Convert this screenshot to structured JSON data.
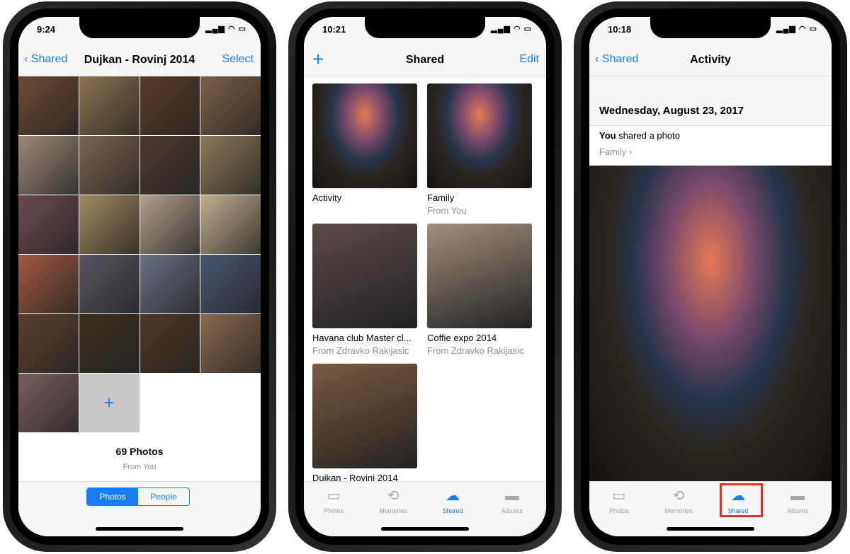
{
  "phone1": {
    "time": "9:24",
    "back": "Shared",
    "title": "Dujkan - Rovinj 2014",
    "right": "Select",
    "count": "69 Photos",
    "from": "From You",
    "segments": [
      "Photos",
      "People"
    ],
    "add_icon": "plus-icon"
  },
  "phone2": {
    "time": "10:21",
    "title": "Shared",
    "right": "Edit",
    "add_icon": "plus-icon",
    "albums": [
      {
        "name": "Activity",
        "sub": ""
      },
      {
        "name": "Family",
        "sub": "From You"
      },
      {
        "name": "Havana club Master cl...",
        "sub": "From Zdravko Rakijasic"
      },
      {
        "name": "Coffie expo 2014",
        "sub": "From Zdravko Rakijasic"
      },
      {
        "name": "Dujkan - Rovinj 2014",
        "sub": ""
      }
    ]
  },
  "phone3": {
    "time": "10:18",
    "back": "Shared",
    "title": "Activity",
    "date": "Wednesday, August 23, 2017",
    "you": "You",
    "action": " shared a photo",
    "album": "Family ›"
  },
  "tabs": [
    {
      "label": "Photos",
      "icon": "photos-icon"
    },
    {
      "label": "Memories",
      "icon": "memories-icon"
    },
    {
      "label": "Shared",
      "icon": "cloud-icon"
    },
    {
      "label": "Albums",
      "icon": "albums-icon"
    }
  ],
  "colors": {
    "accent": "#1a7cf5",
    "highlight": "#e8321e"
  }
}
